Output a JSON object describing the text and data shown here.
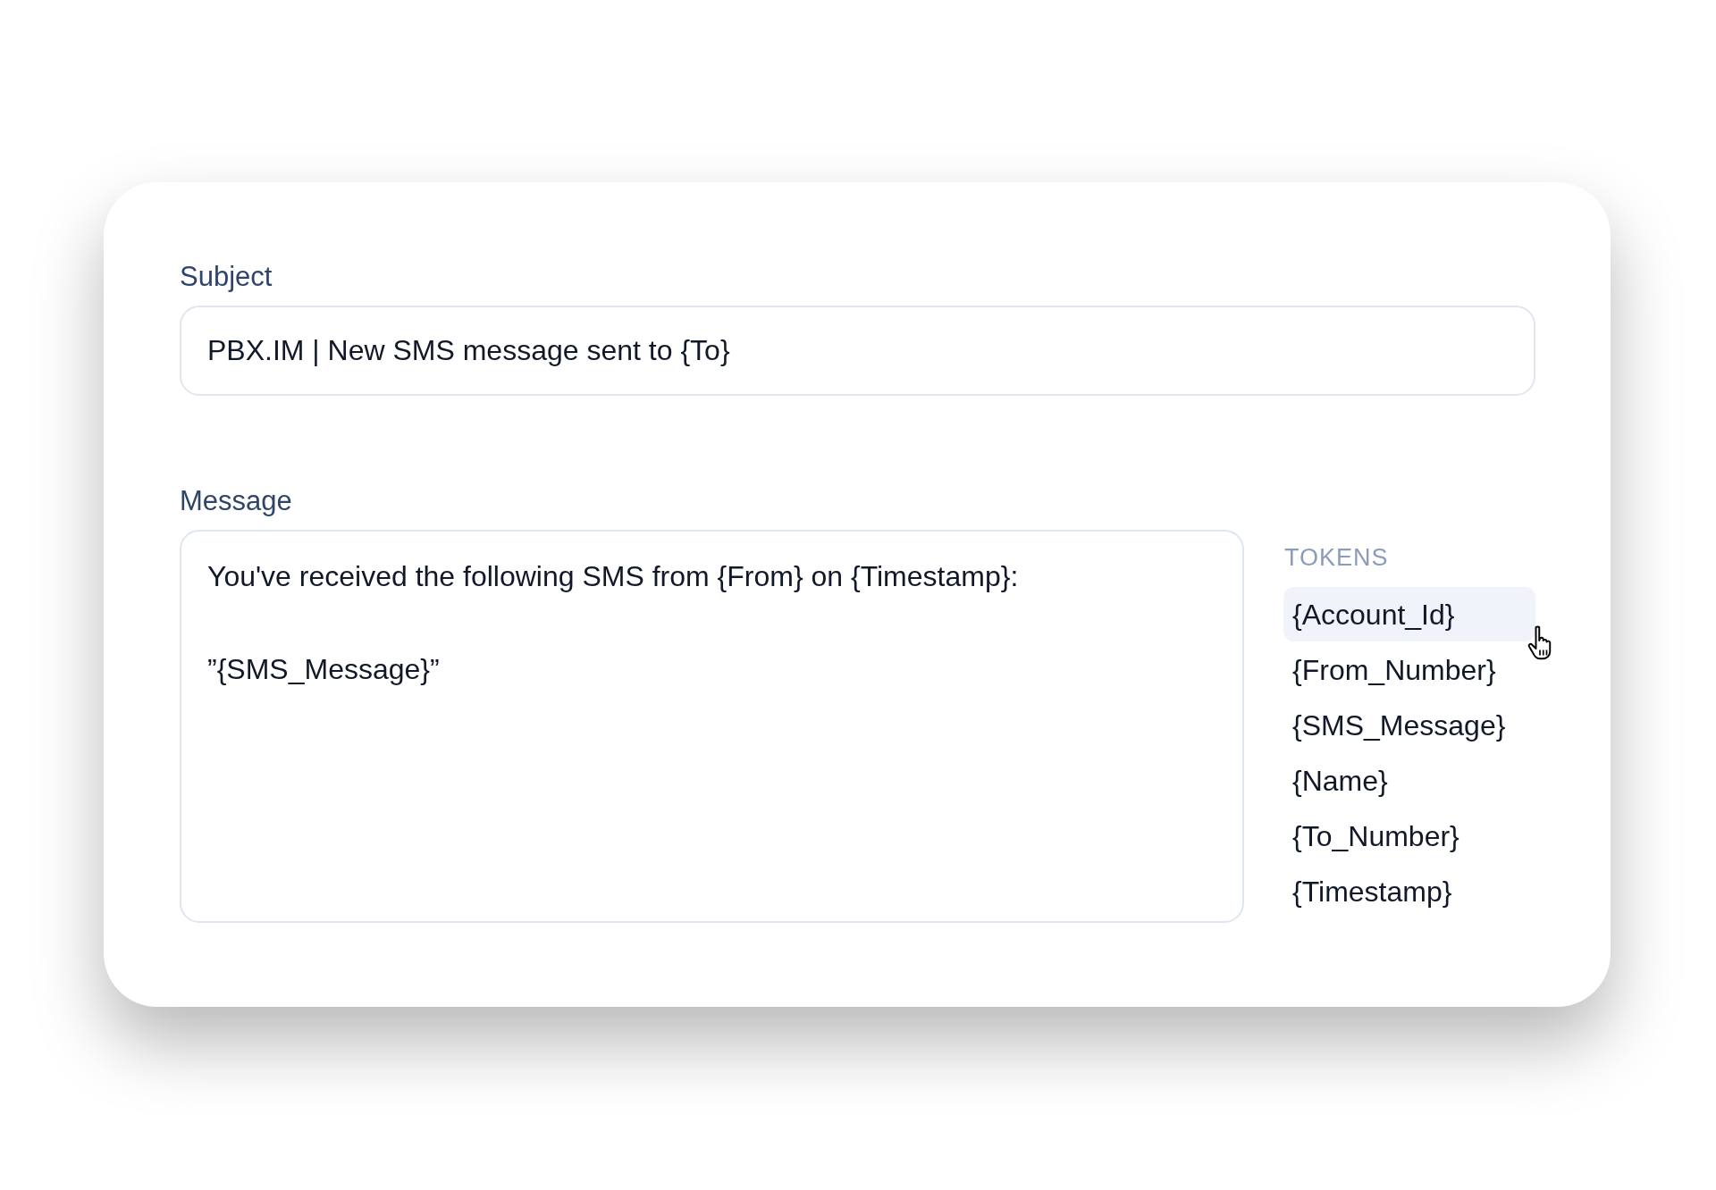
{
  "subject": {
    "label": "Subject",
    "value": "PBX.IM | New SMS message sent to {To}"
  },
  "message": {
    "label": "Message",
    "lines": [
      "You've received the following SMS from {From} on {Timestamp}:",
      "”{SMS_Message}”"
    ]
  },
  "tokens": {
    "heading": "TOKENS",
    "items": [
      {
        "label": "{Account_Id}",
        "hovered": true
      },
      {
        "label": "{From_Number}",
        "hovered": false
      },
      {
        "label": "{SMS_Message}",
        "hovered": false
      },
      {
        "label": "{Name}",
        "hovered": false
      },
      {
        "label": "{To_Number}",
        "hovered": false
      },
      {
        "label": "{Timestamp}",
        "hovered": false
      }
    ]
  }
}
